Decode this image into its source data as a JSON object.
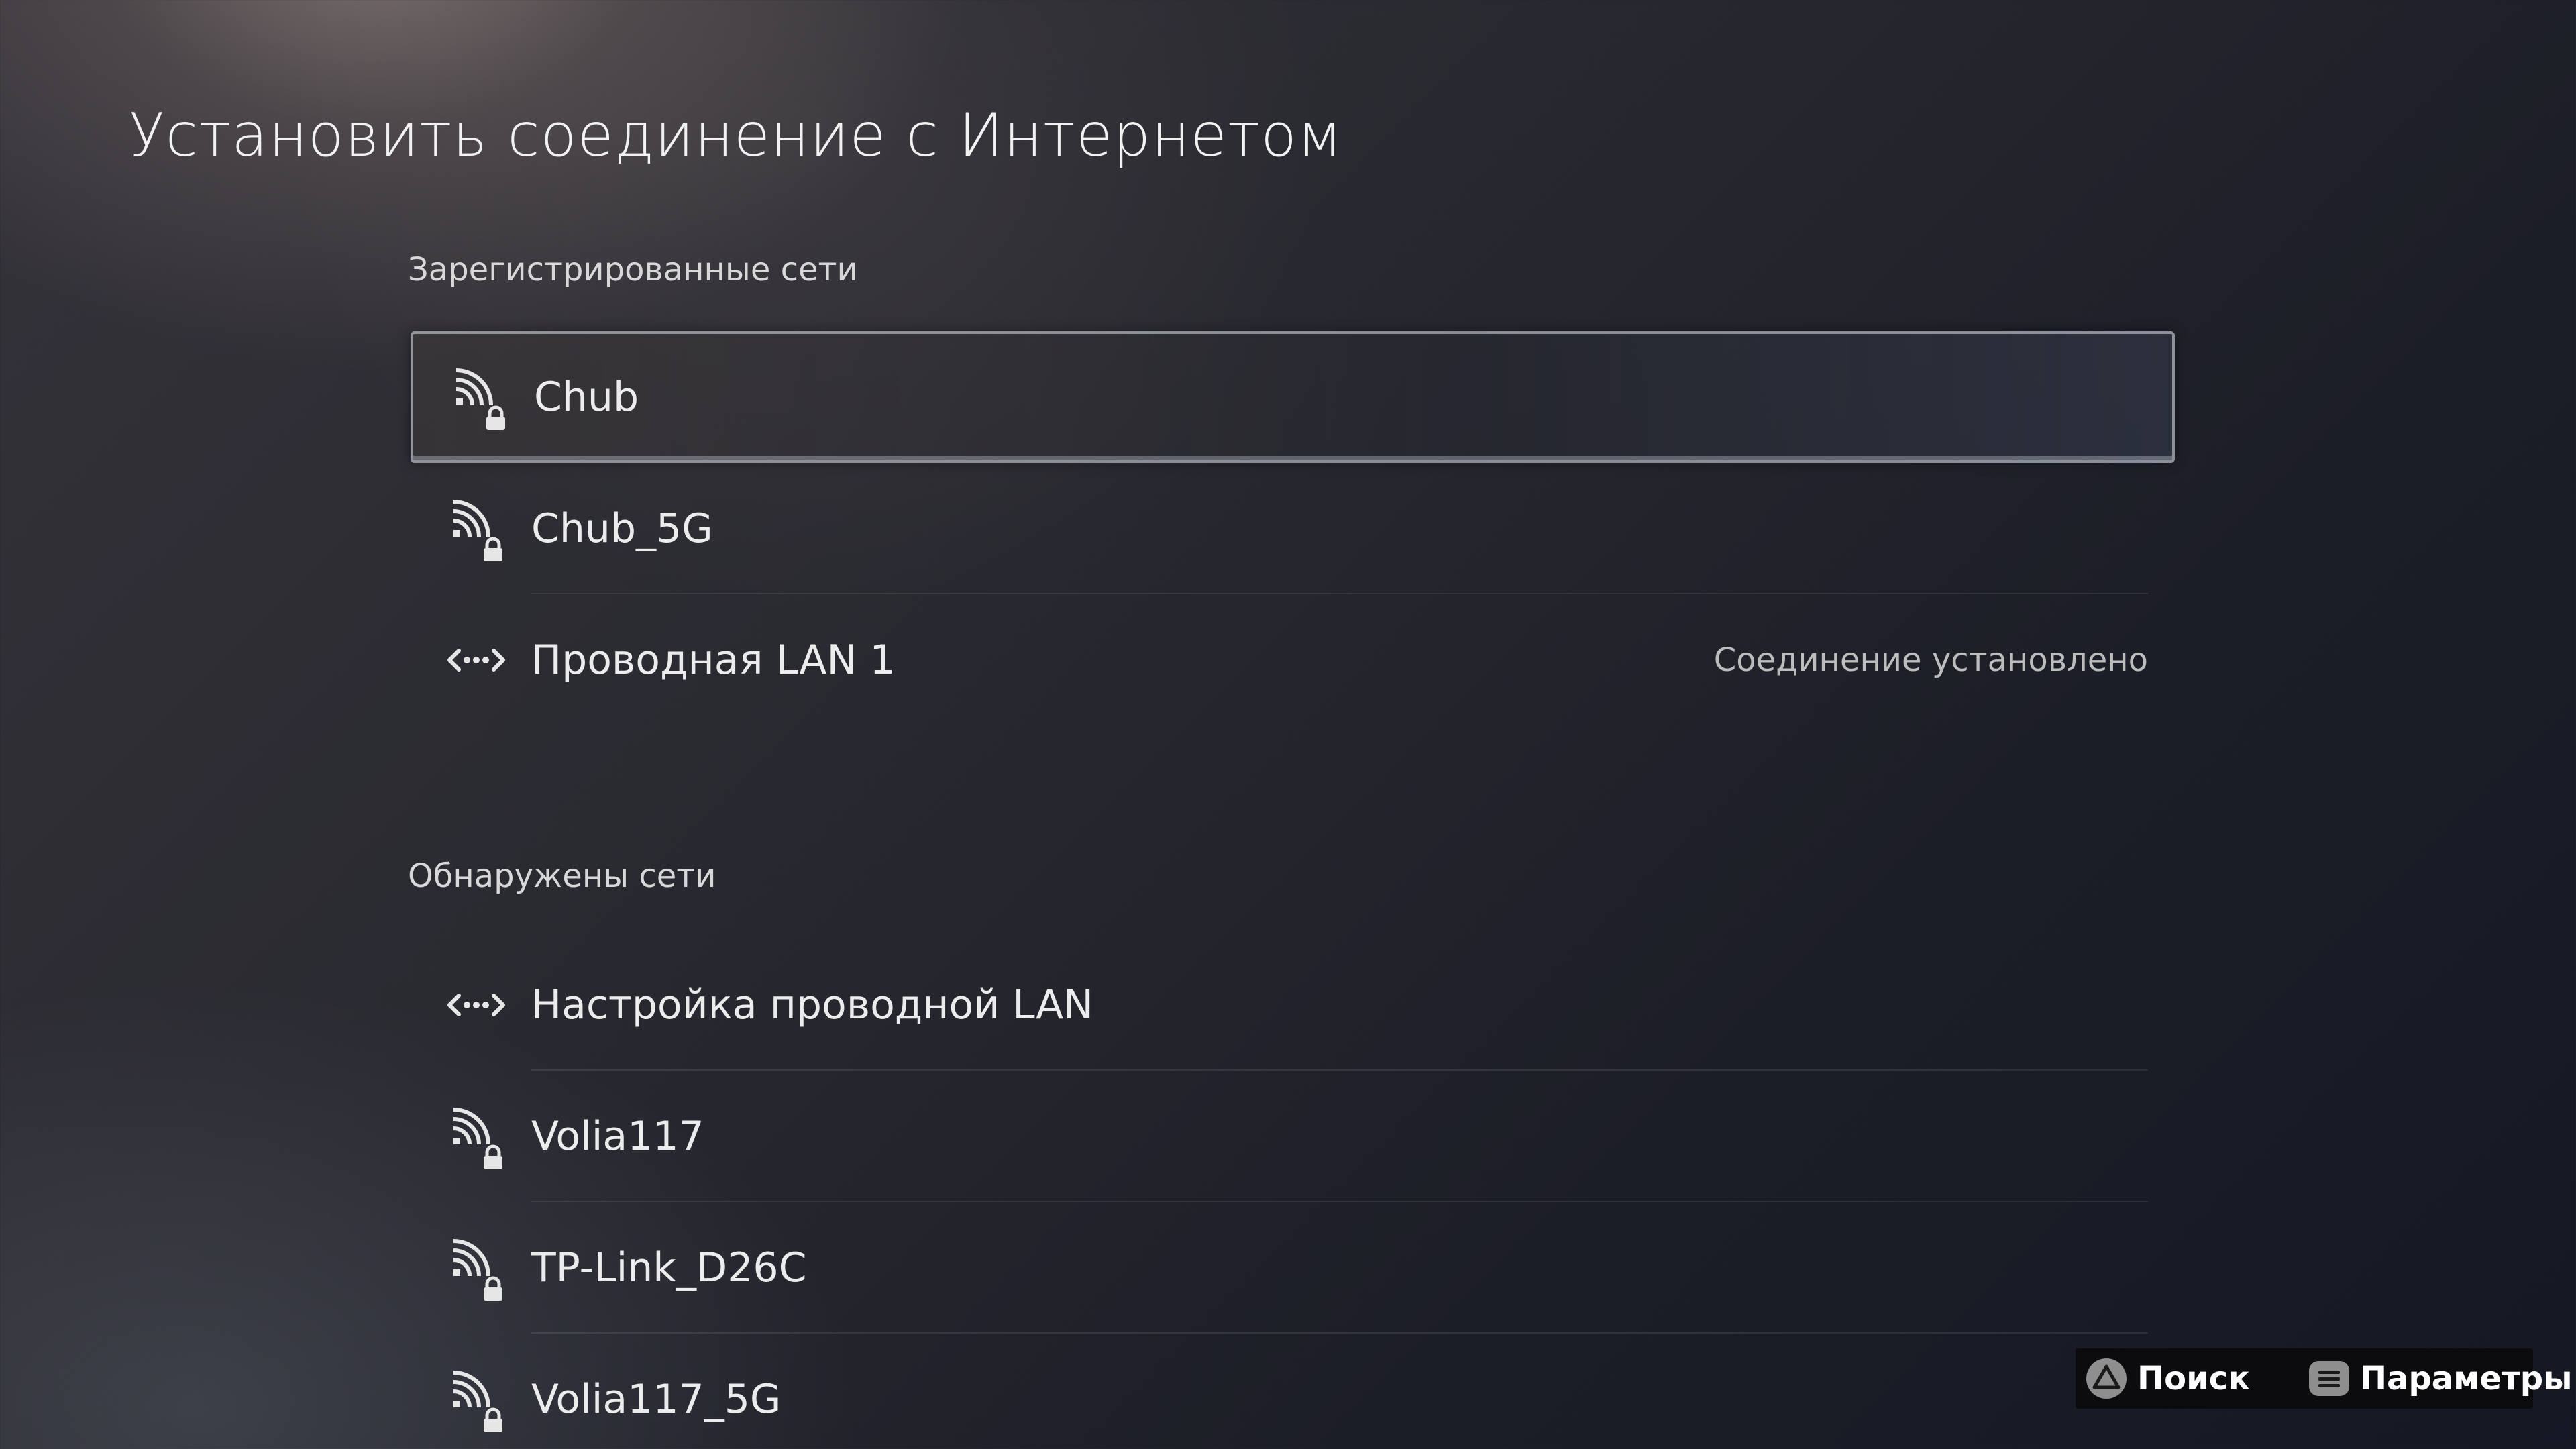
{
  "page": {
    "title": "Установить соединение с Интернетом"
  },
  "registered": {
    "label": "Зарегистрированные сети",
    "items": [
      {
        "name": "Chub",
        "icon": "wifi-lock-icon",
        "status": ""
      },
      {
        "name": "Chub_5G",
        "icon": "wifi-lock-icon",
        "status": ""
      },
      {
        "name": "Проводная LAN 1",
        "icon": "ethernet-icon",
        "status": "Соединение установлено"
      }
    ]
  },
  "detected": {
    "label": "Обнаружены сети",
    "items": [
      {
        "name": "Настройка проводной LAN",
        "icon": "ethernet-icon"
      },
      {
        "name": "Volia117",
        "icon": "wifi-lock-icon"
      },
      {
        "name": "TP-Link_D26C",
        "icon": "wifi-lock-icon"
      },
      {
        "name": "Volia117_5G",
        "icon": "wifi-lock-icon"
      }
    ]
  },
  "hints": {
    "search_label": "Поиск",
    "search_icon": "triangle-button-icon",
    "options_label": "Параметры",
    "options_icon": "options-button-icon"
  },
  "colors": {
    "focus_border": "#dce1eb",
    "text": "#ededed",
    "status_text": "#bdbdbd"
  }
}
